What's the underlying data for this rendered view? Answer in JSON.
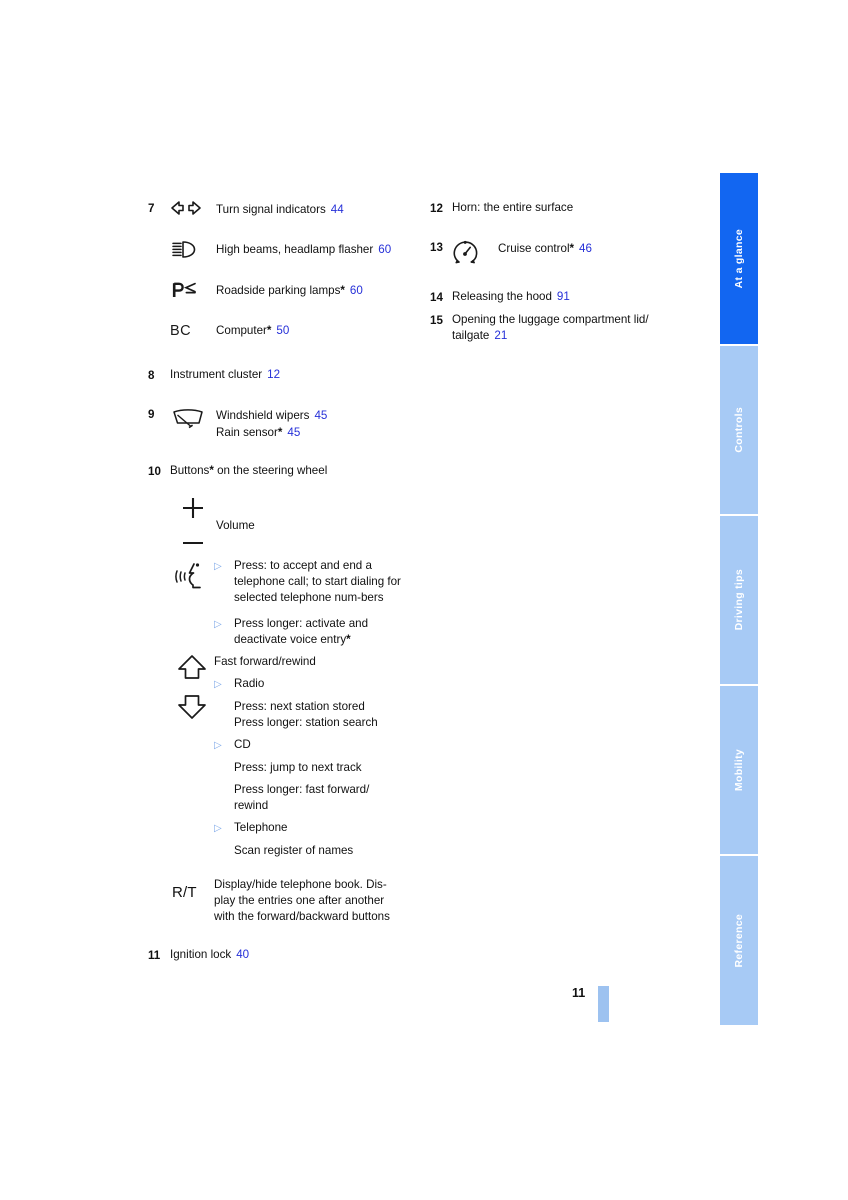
{
  "page": {
    "number": "11",
    "ref_color": "#2630d8",
    "active_tab_color": "#1266f1",
    "inactive_tab_color": "#a7caf5"
  },
  "sidebar": {
    "tabs": [
      {
        "label": "At a glance",
        "active": true
      },
      {
        "label": "Controls",
        "active": false
      },
      {
        "label": "Driving tips",
        "active": false
      },
      {
        "label": "Mobility",
        "active": false
      },
      {
        "label": "Reference",
        "active": false
      }
    ]
  },
  "left_column": {
    "item7": {
      "number": "7",
      "entries": [
        {
          "icon": "turn-signal-icon",
          "label": "Turn signal indicators",
          "ref": "44"
        },
        {
          "icon": "high-beam-icon",
          "label": "High beams, headlamp flasher",
          "ref": "60"
        },
        {
          "icon": "parking-lamp-icon",
          "label": "Roadside parking lamps",
          "star": "*",
          "ref": "60"
        },
        {
          "icon": "computer-bc-icon",
          "label": "Computer",
          "star": "*",
          "ref": "50"
        }
      ]
    },
    "item8": {
      "number": "8",
      "label": "Instrument cluster",
      "ref": "12"
    },
    "item9": {
      "number": "9",
      "icon": "windshield-wiper-icon",
      "line1": "Windshield wipers",
      "ref1": "45",
      "line2": "Rain sensor",
      "star2": "*",
      "ref2": "45"
    },
    "item10": {
      "number": "10",
      "label": "Buttons",
      "star": "*",
      "label_rest": " on the steering wheel",
      "volume": {
        "icon_plus": "plus-icon",
        "icon_minus": "minus-icon",
        "label": "Volume"
      },
      "phone": {
        "icon": "voice-telephone-icon",
        "bullets": [
          "Press: to accept and end a telephone call; to start dialing for selected telephone num-bers",
          "Press longer: activate and deactivate voice entry*"
        ],
        "bullet1": "Press: to accept and end a telephone call; to start dialing for selected telephone num-",
        "bullet1b": "bers",
        "bullet2": "Press longer: activate and",
        "bullet2b": "deactivate voice entry",
        "bullet2star": "*"
      },
      "arrows": {
        "icon_up": "arrow-up-icon",
        "icon_down": "arrow-down-icon",
        "heading": "Fast forward/rewind",
        "groups": [
          {
            "title": "Radio",
            "lines": [
              "Press: next station stored",
              "Press longer: station search"
            ]
          },
          {
            "title": "CD",
            "lines": [
              "Press: jump to next track",
              "Press longer: fast forward/",
              "rewind"
            ]
          },
          {
            "title": "Telephone",
            "lines": [
              "Scan register of names"
            ]
          }
        ]
      },
      "rt": {
        "label": "R/T",
        "lines": [
          "Display/hide telephone book. Dis-",
          "play the entries one after another",
          "with the forward/backward buttons"
        ]
      }
    },
    "item11": {
      "number": "11",
      "label": "Ignition lock",
      "ref": "40"
    }
  },
  "right_column": {
    "item12": {
      "number": "12",
      "label": "Horn: the entire surface"
    },
    "item13": {
      "number": "13",
      "icon": "cruise-control-icon",
      "label": "Cruise control",
      "star": "*",
      "ref": "46"
    },
    "item14": {
      "number": "14",
      "label": "Releasing the hood",
      "ref": "91"
    },
    "item15": {
      "number": "15",
      "line1": "Opening the luggage compartment lid/",
      "line2": "tailgate",
      "ref": "21"
    }
  }
}
